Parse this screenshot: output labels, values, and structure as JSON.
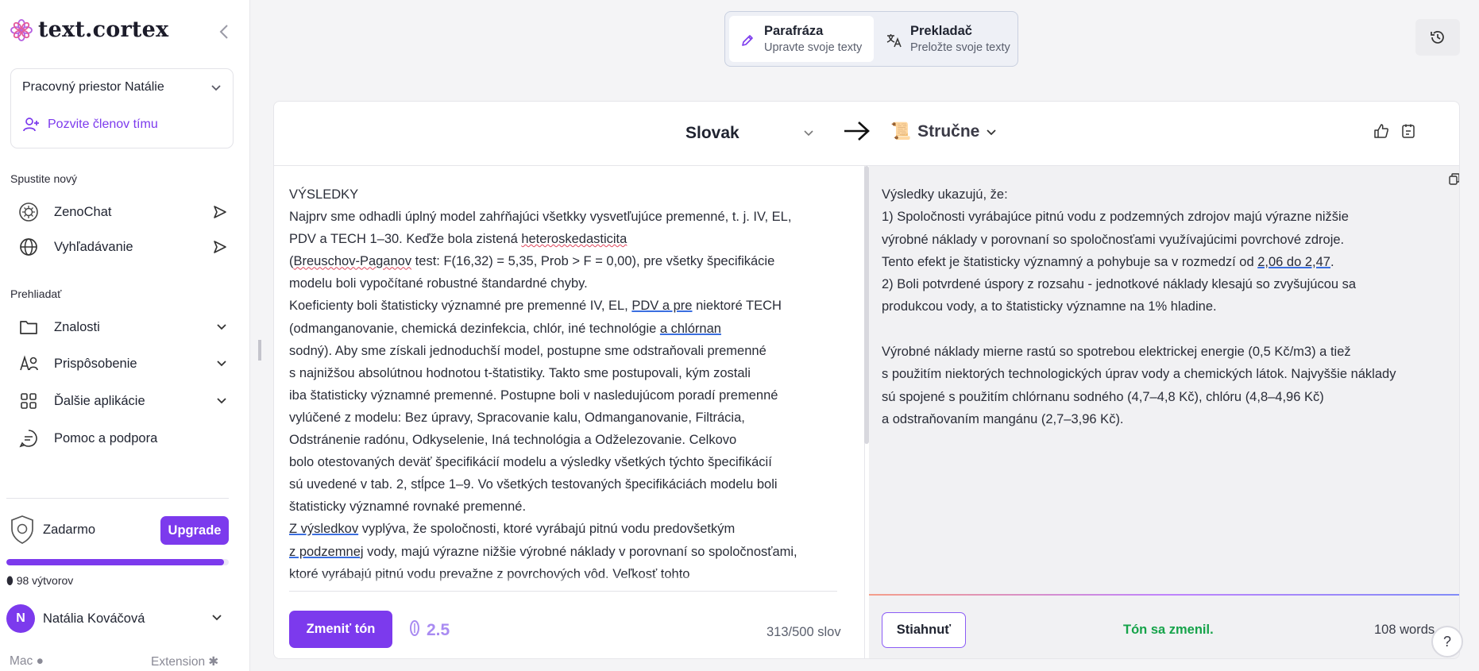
{
  "sidebar": {
    "logo": "text.cortex",
    "workspace": "Pracovný priestor Natálie",
    "invite": "Pozvite členov tímu",
    "start_title": "Spustite nový",
    "start_items": [
      {
        "label": "ZenoChat",
        "icon": "zenochat-icon"
      },
      {
        "label": "Vyhľadávanie",
        "icon": "globe-icon"
      }
    ],
    "browse_title": "Prehliadať",
    "browse_items": [
      {
        "label": "Znalosti",
        "icon": "folder-icon"
      },
      {
        "label": "Prispôsobenie",
        "icon": "customize-icon"
      },
      {
        "label": "Ďalšie aplikácie",
        "icon": "apps-grid-icon"
      },
      {
        "label": "Pomoc a podpora",
        "icon": "chat-bubble-icon"
      }
    ],
    "plan": "Zadarmo",
    "upgrade": "Upgrade",
    "credits_fraction": 0.98,
    "credits": "98 výtvorov",
    "user_initial": "N",
    "user_name": "Natália Kováčová",
    "footer_left": "Mac",
    "footer_right": "Extension"
  },
  "modes": [
    {
      "title": "Parafráza",
      "subtitle": "Upravte svoje texty",
      "active": true
    },
    {
      "title": "Prekladač",
      "subtitle": "Preložte svoje texty",
      "active": false
    }
  ],
  "editor": {
    "language": "Slovak",
    "tone": "Stručne",
    "input_text": "VÝSLEDKY\nNajprv sme odhadli úplný model zahŕňajúci všetkky vysvetľujúce premenné, t. j. IV, EL,\nPDV a TECH 1–30. Keďže bola zistená heteroskedasticita\n(Breuschov-Paganov test: F(16,32) = 5,35, Prob > F = 0,00), pre všetky špecifikácie\nmodelu boli vypočítané robustné štandardné chyby.\nKoeficienty boli štatisticky významné pre premenné IV, EL, PDV a pre niektoré TECH\n(odmanganovanie, chemická dezinfekcia, chlór, iné technológie a chlórnan\nsodný). Aby sme získali jednoduchší model, postupne sme odstraňovali premenné\ns najnižšou absolútnou hodnotou t-štatistiky. Takto sme postupovali, kým zostali\niba štatisticky významné premenné. Postupne boli v nasledujúcom poradí premenné\nvylúčené z modelu: Bez úpravy, Spracovanie kalu, Odmanganovanie, Filtrácia,\nOdstránenie radónu, Odkyselenie, Iná technológia a Odželezovanie. Celkovo\nbolo otestovaných deväť špecifikácií modelu a výsledky všetkých týchto špecifikácií\nsú uvedené v tab. 2, stĺpce 1–9. Vo všetkých testovaných špecifikáciách modelu boli\nštatisticky významné rovnaké premenné.\nZ výsledkov vyplýva, že spoločnosti, ktoré vyrábajú pitnú vodu predovšetkým\nz podzemnej vody, majú výrazne nižšie výrobné náklady v porovnaní so spoločnosťami,\nktoré vyrábajú pitnú vodu prevažne z povrchových vôd. Veľkosť tohto",
    "change_tone": "Zmeniť tón",
    "cost": "2.5",
    "word_count": "313/500 slov",
    "output_text": "Výsledky ukazujú, že:\n1) Spoločnosti vyrábajúce pitnú vodu z podzemných zdrojov majú výrazne nižšie\nvýrobné náklady v porovnaní so spoločnosťami využívajúcimi povrchové zdroje.\nTento efekt je štatisticky významný a pohybuje sa v rozmedzí od 2,06 do 2,47.\n2) Boli potvrdené úspory z rozsahu - jednotkové náklady klesajú so zvyšujúcou sa\nprodukcou vody, a to štatisticky významne na 1% hladine.\n\nVýrobné náklady mierne rastú so spotrebou elektrickej energie (0,5 Kč/m3) a tiež\ns použitím niektorých technologických úprav vody a chemických látok. Najvyššie náklady\nsú spojené s použitím chlórnanu sodného (4,7–4,8 Kč), chlóru (4,8–4,96 Kč)\na odstraňovaním mangánu (2,7–3,96 Kč).",
    "download": "Stiahnuť",
    "status": "Tón sa zmenil.",
    "output_words": "108 words"
  },
  "help": "?",
  "colors": {
    "accent": "#7c3aed",
    "success": "#16a34a"
  }
}
